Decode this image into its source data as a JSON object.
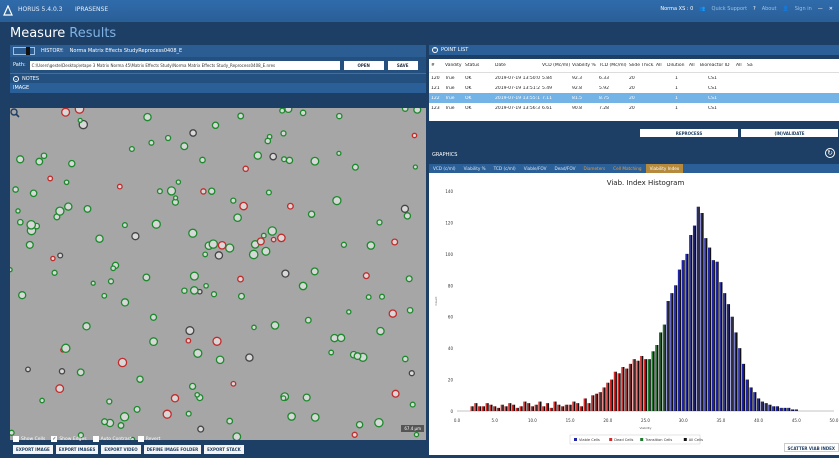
{
  "app": {
    "title": "HORUS 5.4.0.3",
    "project": "IPRASENSE",
    "user": "Norma XS : 0",
    "quick_support": "Quick Support",
    "about": "About",
    "sign_in": "Sign in"
  },
  "page": {
    "title": "Measure",
    "subtitle": "Results"
  },
  "history": {
    "label": "HISTORY:",
    "value": "Norma Matrix Effects StudyReprocess0408_E"
  },
  "path": {
    "label": "Path:",
    "value": "C:\\Users\\geste\\Desktop\\etape 3 Matrix Norma 45\\Matrix Effects Study\\Norma Matrix Effects Study_Reprocess0408_E.nres",
    "open": "OPEN",
    "save": "SAVE"
  },
  "notes": {
    "label": "NOTES"
  },
  "image": {
    "label": "IMAGE"
  },
  "checkboxes": [
    {
      "label": "Show Cells",
      "checked": false
    },
    {
      "label": "Show Edges",
      "checked": true
    },
    {
      "label": "Auto Contrast",
      "checked": false
    },
    {
      "label": "Revert",
      "checked": false
    }
  ],
  "export_buttons": [
    "EXPORT IMAGE",
    "EXPORT IMAGES",
    "EXPORT VIDEO",
    "DEFINE IMAGE FOLDER",
    "EXPORT STACK"
  ],
  "point_list": {
    "label": "POINT LIST",
    "headers": [
      "#",
      "Validity",
      "Status",
      "Date",
      "VCD (Mc/ml)",
      "Viability %",
      "TCD (Mc/ml)",
      "Slide Thick.",
      "All",
      "Dilution",
      "All",
      "Bioreactor ID",
      "All",
      "Sa"
    ],
    "rows": [
      [
        "120",
        "True",
        "OK",
        "2019-07-19 13:50:05",
        "5.84",
        "92.3",
        "6.33",
        "20",
        "1",
        "CS1"
      ],
      [
        "121",
        "True",
        "OK",
        "2019-07-19 13:51:28",
        "5.49",
        "92.8",
        "5.92",
        "20",
        "1",
        "CS1"
      ],
      [
        "122",
        "True",
        "OK",
        "2019-07-19 13:55:13",
        "7.11",
        "81.5",
        "8.75",
        "20",
        "1",
        "CS1"
      ],
      [
        "123",
        "True",
        "OK",
        "2019-07-19 13:56:37",
        "6.61",
        "90.8",
        "7.28",
        "20",
        "1",
        "CS1"
      ]
    ],
    "selected_row": 2,
    "reprocess": "REPROCESS",
    "invalidate": "(IN)VALIDATE"
  },
  "graphics": {
    "label": "GRAPHICS",
    "tabs": [
      "VCD (c/ml)",
      "Viability %",
      "TCD (c/ml)",
      "Viable/FOV",
      "Dead/FOV",
      "Diameters",
      "Cell Matching",
      "Viability Index"
    ],
    "active_tab": 7,
    "scatter_button": "SCATTER VIAB INDEX"
  },
  "chart_data": {
    "type": "bar",
    "title": "Viab. Index Histogram",
    "xlabel": "Viability",
    "ylabel": "Count",
    "ylim": [
      0,
      140
    ],
    "xlim": [
      0,
      50
    ],
    "yticks": [
      "0",
      "20",
      "40",
      "60",
      "80",
      "100",
      "120",
      "140"
    ],
    "xticks": [
      "0.0",
      "5.0",
      "10.0",
      "15.0",
      "20.0",
      "25.0",
      "30.0",
      "35.0",
      "40.0",
      "45.0",
      "50.0"
    ],
    "legend": [
      "Viable Cells",
      "Dead Cells",
      "Transition Cells",
      "All Cells"
    ],
    "colors": {
      "viable": "#1f24a8",
      "dead": "#d42a2a",
      "transition": "#1b7a2c",
      "all": "#111111"
    },
    "bins": [
      {
        "x": 2.0,
        "v": 0,
        "d": 3,
        "t": 0,
        "a": 3
      },
      {
        "x": 2.5,
        "v": 0,
        "d": 5,
        "t": 0,
        "a": 5
      },
      {
        "x": 3.0,
        "v": 0,
        "d": 3,
        "t": 0,
        "a": 3
      },
      {
        "x": 3.5,
        "v": 0,
        "d": 3,
        "t": 0,
        "a": 3
      },
      {
        "x": 4.0,
        "v": 0,
        "d": 5,
        "t": 0,
        "a": 5
      },
      {
        "x": 4.5,
        "v": 0,
        "d": 4,
        "t": 0,
        "a": 4
      },
      {
        "x": 5.0,
        "v": 0,
        "d": 3,
        "t": 0,
        "a": 3
      },
      {
        "x": 5.5,
        "v": 0,
        "d": 2,
        "t": 0,
        "a": 2
      },
      {
        "x": 6.0,
        "v": 0,
        "d": 4,
        "t": 0,
        "a": 4
      },
      {
        "x": 6.5,
        "v": 0,
        "d": 3,
        "t": 0,
        "a": 3
      },
      {
        "x": 7.0,
        "v": 0,
        "d": 5,
        "t": 0,
        "a": 5
      },
      {
        "x": 7.5,
        "v": 0,
        "d": 4,
        "t": 0,
        "a": 4
      },
      {
        "x": 8.0,
        "v": 0,
        "d": 2,
        "t": 0,
        "a": 2
      },
      {
        "x": 8.5,
        "v": 0,
        "d": 3,
        "t": 0,
        "a": 3
      },
      {
        "x": 9.0,
        "v": 0,
        "d": 6,
        "t": 0,
        "a": 6
      },
      {
        "x": 9.5,
        "v": 0,
        "d": 5,
        "t": 0,
        "a": 5
      },
      {
        "x": 10.0,
        "v": 0,
        "d": 3,
        "t": 0,
        "a": 3
      },
      {
        "x": 10.5,
        "v": 0,
        "d": 4,
        "t": 0,
        "a": 4
      },
      {
        "x": 11.0,
        "v": 0,
        "d": 6,
        "t": 0,
        "a": 6
      },
      {
        "x": 11.5,
        "v": 0,
        "d": 3,
        "t": 0,
        "a": 3
      },
      {
        "x": 12.0,
        "v": 0,
        "d": 5,
        "t": 0,
        "a": 5
      },
      {
        "x": 12.5,
        "v": 0,
        "d": 2,
        "t": 0,
        "a": 2
      },
      {
        "x": 13.0,
        "v": 0,
        "d": 6,
        "t": 0,
        "a": 6
      },
      {
        "x": 13.5,
        "v": 0,
        "d": 4,
        "t": 0,
        "a": 4
      },
      {
        "x": 14.0,
        "v": 0,
        "d": 3,
        "t": 0,
        "a": 3
      },
      {
        "x": 14.5,
        "v": 0,
        "d": 4,
        "t": 0,
        "a": 4
      },
      {
        "x": 15.0,
        "v": 0,
        "d": 4,
        "t": 0,
        "a": 4
      },
      {
        "x": 15.5,
        "v": 0,
        "d": 6,
        "t": 0,
        "a": 6
      },
      {
        "x": 16.0,
        "v": 0,
        "d": 5,
        "t": 0,
        "a": 5
      },
      {
        "x": 16.5,
        "v": 0,
        "d": 3,
        "t": 0,
        "a": 3
      },
      {
        "x": 17.0,
        "v": 0,
        "d": 8,
        "t": 0,
        "a": 8
      },
      {
        "x": 17.5,
        "v": 0,
        "d": 5,
        "t": 0,
        "a": 5
      },
      {
        "x": 18.0,
        "v": 0,
        "d": 10,
        "t": 0,
        "a": 10
      },
      {
        "x": 18.5,
        "v": 0,
        "d": 11,
        "t": 0,
        "a": 11
      },
      {
        "x": 19.0,
        "v": 0,
        "d": 12,
        "t": 0,
        "a": 12
      },
      {
        "x": 19.5,
        "v": 0,
        "d": 15,
        "t": 0,
        "a": 15
      },
      {
        "x": 20.0,
        "v": 0,
        "d": 18,
        "t": 0,
        "a": 18
      },
      {
        "x": 20.5,
        "v": 0,
        "d": 20,
        "t": 0,
        "a": 20
      },
      {
        "x": 21.0,
        "v": 0,
        "d": 25,
        "t": 0,
        "a": 25
      },
      {
        "x": 21.5,
        "v": 0,
        "d": 24,
        "t": 0,
        "a": 24
      },
      {
        "x": 22.0,
        "v": 0,
        "d": 28,
        "t": 0,
        "a": 28
      },
      {
        "x": 22.5,
        "v": 0,
        "d": 27,
        "t": 0,
        "a": 27
      },
      {
        "x": 23.0,
        "v": 0,
        "d": 30,
        "t": 0,
        "a": 30
      },
      {
        "x": 23.5,
        "v": 0,
        "d": 33,
        "t": 0,
        "a": 33
      },
      {
        "x": 24.0,
        "v": 0,
        "d": 32,
        "t": 0,
        "a": 32
      },
      {
        "x": 24.5,
        "v": 0,
        "d": 35,
        "t": 0,
        "a": 35
      },
      {
        "x": 25.0,
        "v": 0,
        "d": 33,
        "t": 0,
        "a": 33
      },
      {
        "x": 25.5,
        "v": 0,
        "d": 0,
        "t": 33,
        "a": 33
      },
      {
        "x": 26.0,
        "v": 0,
        "d": 0,
        "t": 38,
        "a": 38
      },
      {
        "x": 26.5,
        "v": 0,
        "d": 0,
        "t": 42,
        "a": 42
      },
      {
        "x": 27.0,
        "v": 0,
        "d": 0,
        "t": 50,
        "a": 50
      },
      {
        "x": 27.5,
        "v": 0,
        "d": 0,
        "t": 55,
        "a": 55
      },
      {
        "x": 28.0,
        "v": 70,
        "d": 0,
        "t": 0,
        "a": 70
      },
      {
        "x": 28.5,
        "v": 75,
        "d": 0,
        "t": 0,
        "a": 75
      },
      {
        "x": 29.0,
        "v": 80,
        "d": 0,
        "t": 0,
        "a": 80
      },
      {
        "x": 29.5,
        "v": 90,
        "d": 0,
        "t": 0,
        "a": 90
      },
      {
        "x": 30.0,
        "v": 96,
        "d": 0,
        "t": 0,
        "a": 96
      },
      {
        "x": 30.5,
        "v": 100,
        "d": 0,
        "t": 0,
        "a": 100
      },
      {
        "x": 31.0,
        "v": 112,
        "d": 0,
        "t": 0,
        "a": 112
      },
      {
        "x": 31.5,
        "v": 118,
        "d": 0,
        "t": 0,
        "a": 118
      },
      {
        "x": 32.0,
        "v": 130,
        "d": 0,
        "t": 0,
        "a": 130
      },
      {
        "x": 32.5,
        "v": 126,
        "d": 0,
        "t": 0,
        "a": 126
      },
      {
        "x": 33.0,
        "v": 110,
        "d": 0,
        "t": 0,
        "a": 110
      },
      {
        "x": 33.5,
        "v": 104,
        "d": 0,
        "t": 0,
        "a": 104
      },
      {
        "x": 34.0,
        "v": 96,
        "d": 0,
        "t": 0,
        "a": 96
      },
      {
        "x": 34.5,
        "v": 95,
        "d": 0,
        "t": 0,
        "a": 95
      },
      {
        "x": 35.0,
        "v": 82,
        "d": 0,
        "t": 0,
        "a": 82
      },
      {
        "x": 35.5,
        "v": 75,
        "d": 0,
        "t": 0,
        "a": 75
      },
      {
        "x": 36.0,
        "v": 68,
        "d": 0,
        "t": 0,
        "a": 68
      },
      {
        "x": 36.5,
        "v": 60,
        "d": 0,
        "t": 0,
        "a": 60
      },
      {
        "x": 37.0,
        "v": 50,
        "d": 0,
        "t": 0,
        "a": 50
      },
      {
        "x": 37.5,
        "v": 40,
        "d": 0,
        "t": 0,
        "a": 40
      },
      {
        "x": 38.0,
        "v": 30,
        "d": 0,
        "t": 0,
        "a": 30
      },
      {
        "x": 38.5,
        "v": 20,
        "d": 0,
        "t": 0,
        "a": 20
      },
      {
        "x": 39.0,
        "v": 15,
        "d": 0,
        "t": 0,
        "a": 15
      },
      {
        "x": 39.5,
        "v": 12,
        "d": 0,
        "t": 0,
        "a": 12
      },
      {
        "x": 40.0,
        "v": 8,
        "d": 0,
        "t": 0,
        "a": 8
      },
      {
        "x": 40.5,
        "v": 6,
        "d": 0,
        "t": 0,
        "a": 6
      },
      {
        "x": 41.0,
        "v": 5,
        "d": 0,
        "t": 0,
        "a": 5
      },
      {
        "x": 41.5,
        "v": 4,
        "d": 0,
        "t": 0,
        "a": 4
      },
      {
        "x": 42.0,
        "v": 3,
        "d": 0,
        "t": 0,
        "a": 3
      },
      {
        "x": 42.5,
        "v": 3,
        "d": 0,
        "t": 0,
        "a": 3
      },
      {
        "x": 43.0,
        "v": 2,
        "d": 0,
        "t": 0,
        "a": 2
      },
      {
        "x": 43.5,
        "v": 2,
        "d": 0,
        "t": 0,
        "a": 2
      },
      {
        "x": 44.0,
        "v": 2,
        "d": 0,
        "t": 0,
        "a": 2
      },
      {
        "x": 44.5,
        "v": 1,
        "d": 0,
        "t": 0,
        "a": 1
      },
      {
        "x": 45.0,
        "v": 1,
        "d": 0,
        "t": 0,
        "a": 1
      }
    ]
  },
  "zoom_readout": "67.4 µm",
  "colors": {
    "bg": "#1d3f66",
    "header": "#2a5f97",
    "accent": "#7fb2e4",
    "selected": "#74b3e6",
    "orange": "#e89b3c"
  }
}
